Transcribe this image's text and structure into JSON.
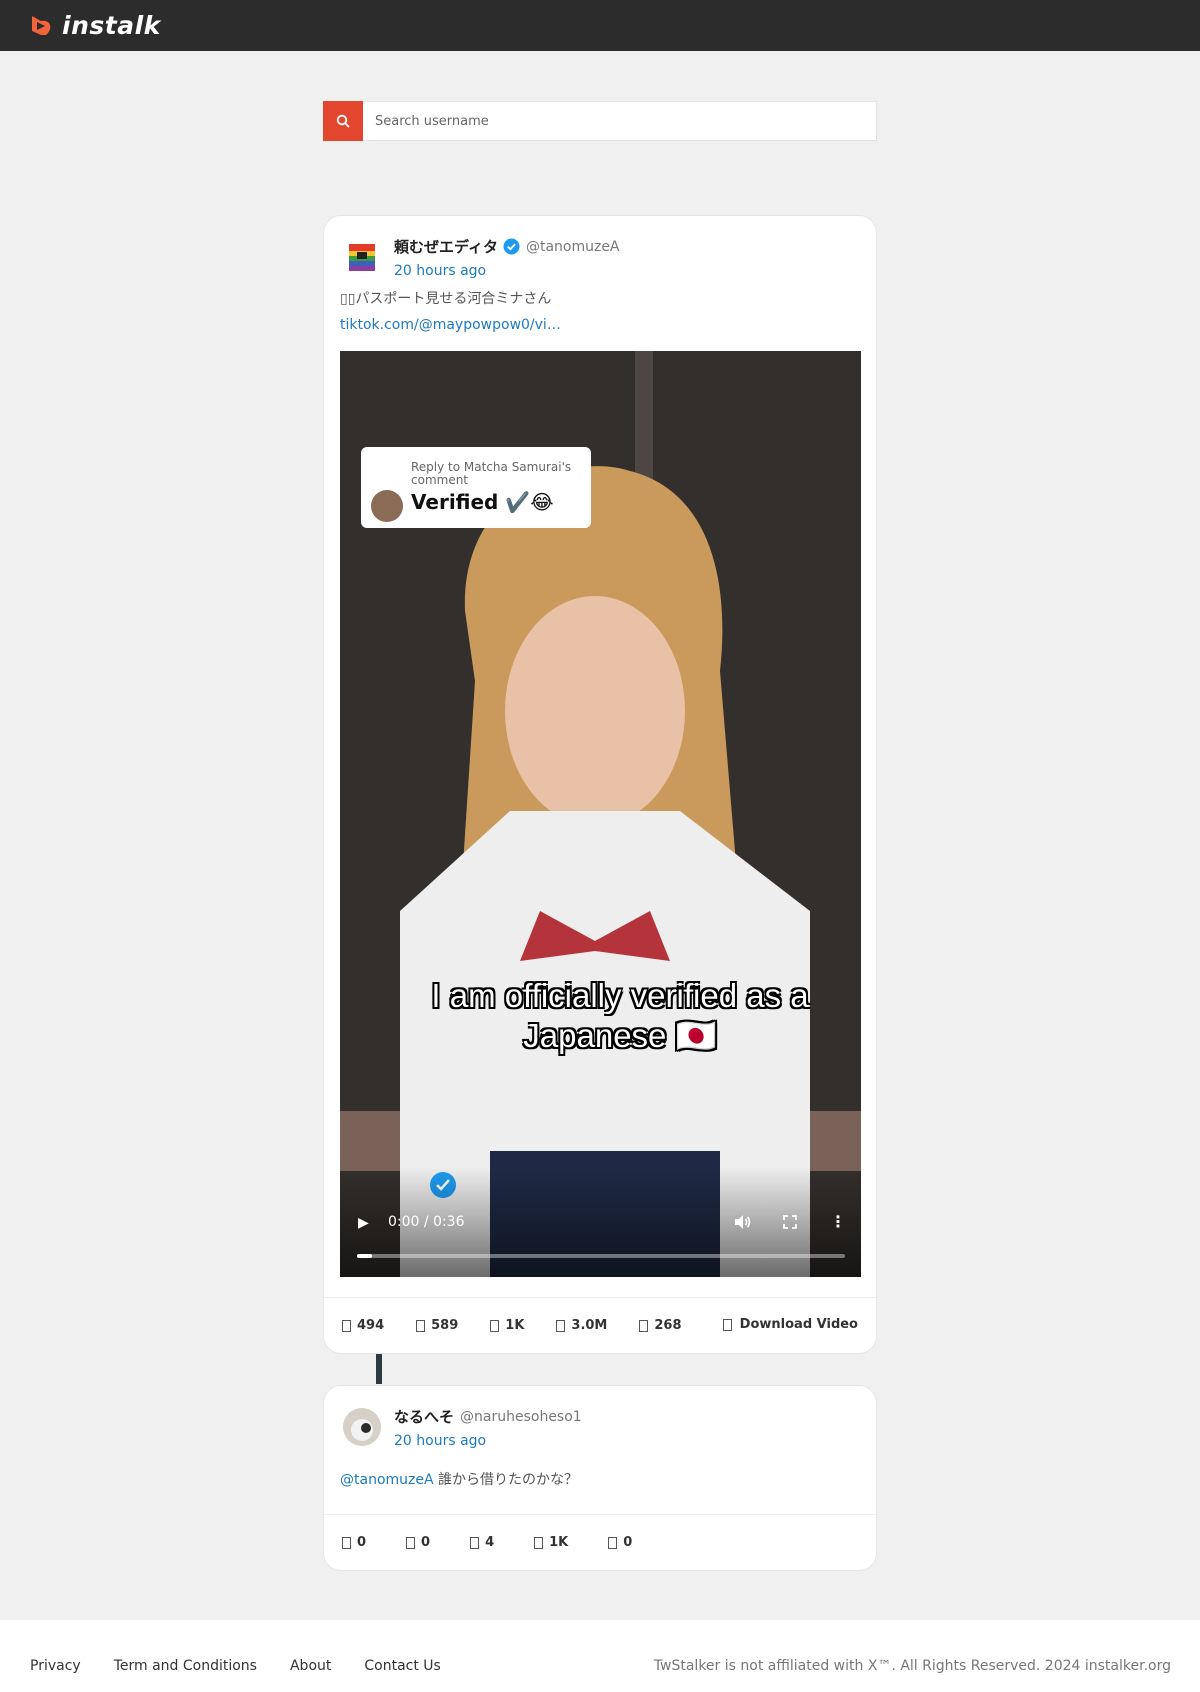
{
  "header": {
    "logo_text": "instalk"
  },
  "search": {
    "placeholder": "Search username",
    "icon": "search-icon",
    "button_color": "#e3462f"
  },
  "posts": [
    {
      "author_name": "頼むぜエディタ",
      "author_handle": "@tanomuzeA",
      "verified": true,
      "time": "20 hours ago",
      "text": "パスポート見せる河合ミナさん",
      "link": "tiktok.com/@maypowpow0/vi…",
      "video": {
        "reply_label": "Reply to Matcha Samurai's comment",
        "reply_text": "Verified ✔️😂",
        "caption_line1": "I am officially verified as a",
        "caption_line2": "Japanese 🇯🇵",
        "time_display": "0:00 / 0:36",
        "progress": 0.03
      },
      "stats": [
        "494",
        "589",
        "1K",
        "3.0M",
        "268"
      ],
      "download_label": "Download Video"
    },
    {
      "author_name": "なるへそ",
      "author_handle": "@naruhesoheso1",
      "time": "20 hours ago",
      "mention": "@tanomuzeA",
      "text": "誰から借りたのかな？",
      "stats": [
        "0",
        "0",
        "4",
        "1K",
        "0"
      ]
    }
  ],
  "footer": {
    "links": [
      "Privacy",
      "Term and Conditions",
      "About",
      "Contact Us"
    ],
    "copyright": "TwStalker is not affiliated with X™. All Rights Reserved.  2024 instalker.org"
  }
}
